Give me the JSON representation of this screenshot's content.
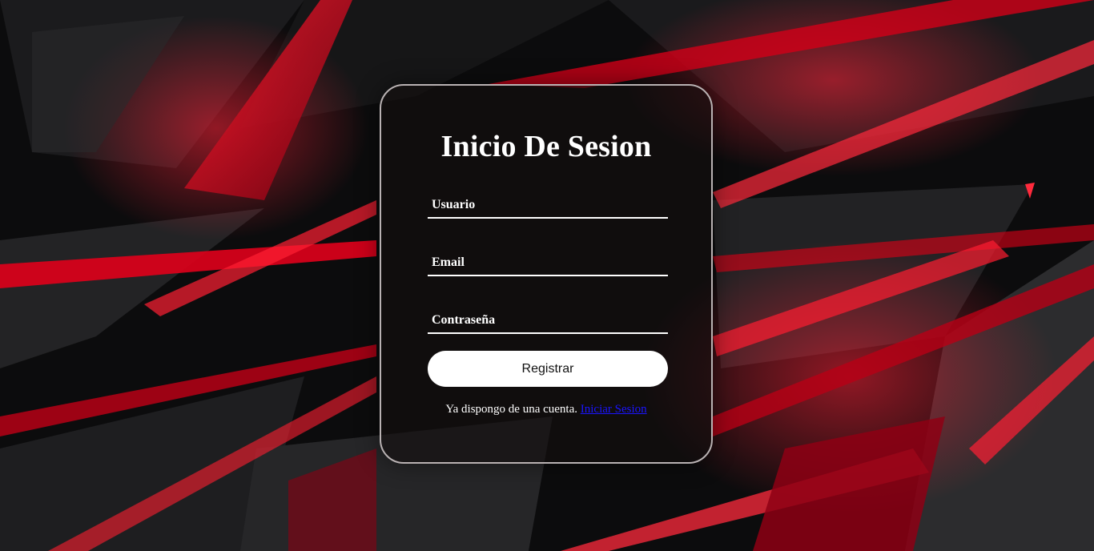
{
  "login": {
    "title": "Inicio De Sesion",
    "fields": [
      {
        "label": "Usuario"
      },
      {
        "label": "Email"
      },
      {
        "label": "Contraseña"
      }
    ],
    "submit_label": "Registrar",
    "footer_text": "Ya dispongo de una cuenta.",
    "footer_link": "Iniciar Sesion"
  },
  "colors": {
    "background": "#0c0c0d",
    "accent_red": "#e0001b",
    "link": "#1a14ff",
    "button_bg": "#ffffff"
  }
}
